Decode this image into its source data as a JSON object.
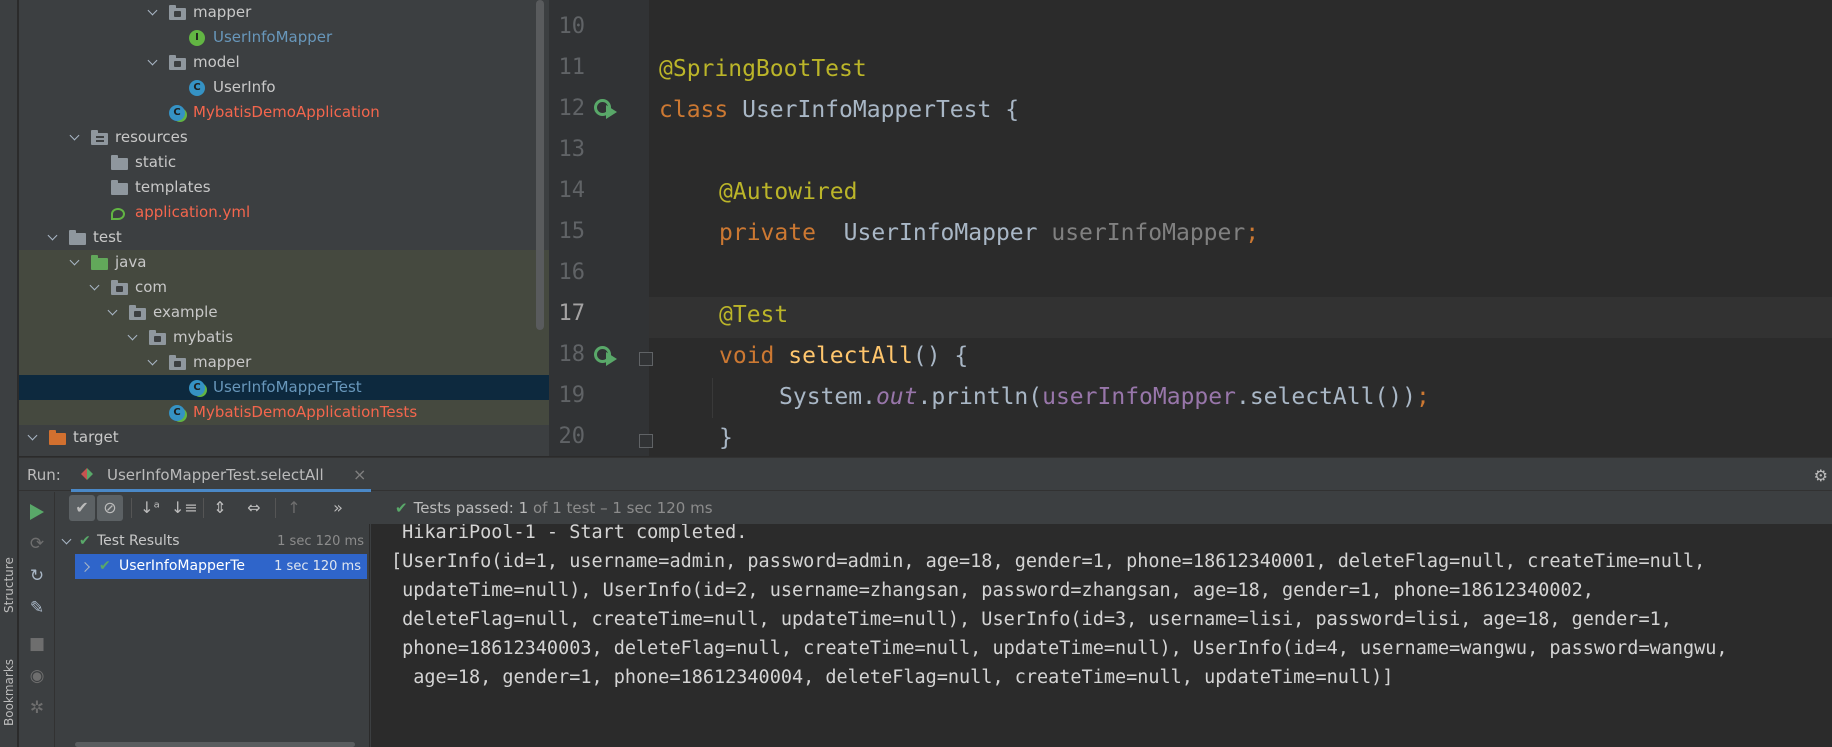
{
  "side_tabs": {
    "structure": "Structure",
    "bookmarks": "Bookmarks"
  },
  "project_tree": [
    {
      "label": "mapper",
      "kind": "package",
      "color": "default",
      "expanded": true
    },
    {
      "label": "UserInfoMapper",
      "kind": "interface",
      "color": "blue"
    },
    {
      "label": "model",
      "kind": "package",
      "color": "default",
      "expanded": true
    },
    {
      "label": "UserInfo",
      "kind": "class",
      "color": "default"
    },
    {
      "label": "MybatisDemoApplication",
      "kind": "class-runnable",
      "color": "red"
    },
    {
      "label": "resources",
      "kind": "resources-folder",
      "color": "default",
      "expanded": true
    },
    {
      "label": "static",
      "kind": "folder",
      "color": "default"
    },
    {
      "label": "templates",
      "kind": "folder",
      "color": "default"
    },
    {
      "label": "application.yml",
      "kind": "yml",
      "color": "red"
    },
    {
      "label": "test",
      "kind": "folder",
      "color": "default",
      "expanded": true
    },
    {
      "label": "java",
      "kind": "test-source-folder",
      "color": "default",
      "expanded": true
    },
    {
      "label": "com",
      "kind": "package",
      "color": "default",
      "expanded": true
    },
    {
      "label": "example",
      "kind": "package",
      "color": "default",
      "expanded": true
    },
    {
      "label": "mybatis",
      "kind": "package",
      "color": "default",
      "expanded": true
    },
    {
      "label": "mapper",
      "kind": "package",
      "color": "default",
      "expanded": true
    },
    {
      "label": "UserInfoMapperTest",
      "kind": "class-runnable",
      "color": "blue",
      "selected": true
    },
    {
      "label": "MybatisDemoApplicationTests",
      "kind": "class-runnable",
      "color": "red"
    },
    {
      "label": "target",
      "kind": "excluded-folder",
      "color": "default",
      "expanded": true
    }
  ],
  "editor": {
    "current_line": "17",
    "lines": [
      {
        "num": "10"
      },
      {
        "num": "11"
      },
      {
        "num": "12"
      },
      {
        "num": "13"
      },
      {
        "num": "14"
      },
      {
        "num": "15"
      },
      {
        "num": "16"
      },
      {
        "num": "17"
      },
      {
        "num": "18"
      },
      {
        "num": "19"
      },
      {
        "num": "20"
      }
    ],
    "code": {
      "l11_ann": "@SpringBootTest",
      "l12_kw": "class",
      "l12_name": " UserInfoMapperTest {",
      "l14_ann": "@Autowired",
      "l15_kw": "private",
      "l15_type": "  UserInfoMapper ",
      "l15_field": "userInfoMapper",
      "l15_semi": ";",
      "l17_ann": "@Test",
      "l18_kw": "void",
      "l18_fn": "selectAll",
      "l18_rest": "() {",
      "l19_sys": "System.",
      "l19_out": "out",
      "l19_println": ".println(",
      "l19_field": "userInfoMapper",
      "l19_call": ".selectAll())",
      "l19_semi": ";",
      "l20_close": "}"
    }
  },
  "run_panel": {
    "label": "Run:",
    "tab_title": "UserInfoMapperTest.selectAll",
    "tab_close": "×",
    "gear": "⚙",
    "status_prefix": "Tests passed:",
    "status_count": "1",
    "status_detail": "of 1 test – 1 sec 120 ms",
    "toolbar": {
      "show_passed": "✔",
      "show_ignored": "⊘",
      "sort_alpha": "↓ᵃ",
      "sort_duration": "↓≡",
      "expand_all": "⇕",
      "collapse_all": "⇔",
      "prev_failed": "↑",
      "more": "»"
    },
    "results": [
      {
        "label": "Test Results",
        "time": "1 sec 120 ms"
      },
      {
        "label": "UserInfoMapperTe",
        "time": "1 sec 120 ms",
        "selected": true
      }
    ],
    "console_lines": [
      " HikariPool-1 - Start completed.",
      "[UserInfo(id=1, username=admin, password=admin, age=18, gender=1, phone=18612340001, deleteFlag=null, createTime=null,",
      " updateTime=null), UserInfo(id=2, username=zhangsan, password=zhangsan, age=18, gender=1, phone=18612340002,",
      " deleteFlag=null, createTime=null, updateTime=null), UserInfo(id=3, username=lisi, password=lisi, age=18, gender=1,",
      " phone=18612340003, deleteFlag=null, createTime=null, updateTime=null), UserInfo(id=4, username=wangwu, password=wangwu,",
      "  age=18, gender=1, phone=18612340004, deleteFlag=null, createTime=null, updateTime=null)]"
    ]
  },
  "colors": {
    "panel_bg": "#3c3f41",
    "editor_bg": "#2b2b2b",
    "annotation": "#bbb529",
    "keyword": "#cc7832",
    "method": "#ffc66d",
    "field": "#9876aa",
    "pass_green": "#59a869",
    "selection_blue": "#2f65ca"
  }
}
